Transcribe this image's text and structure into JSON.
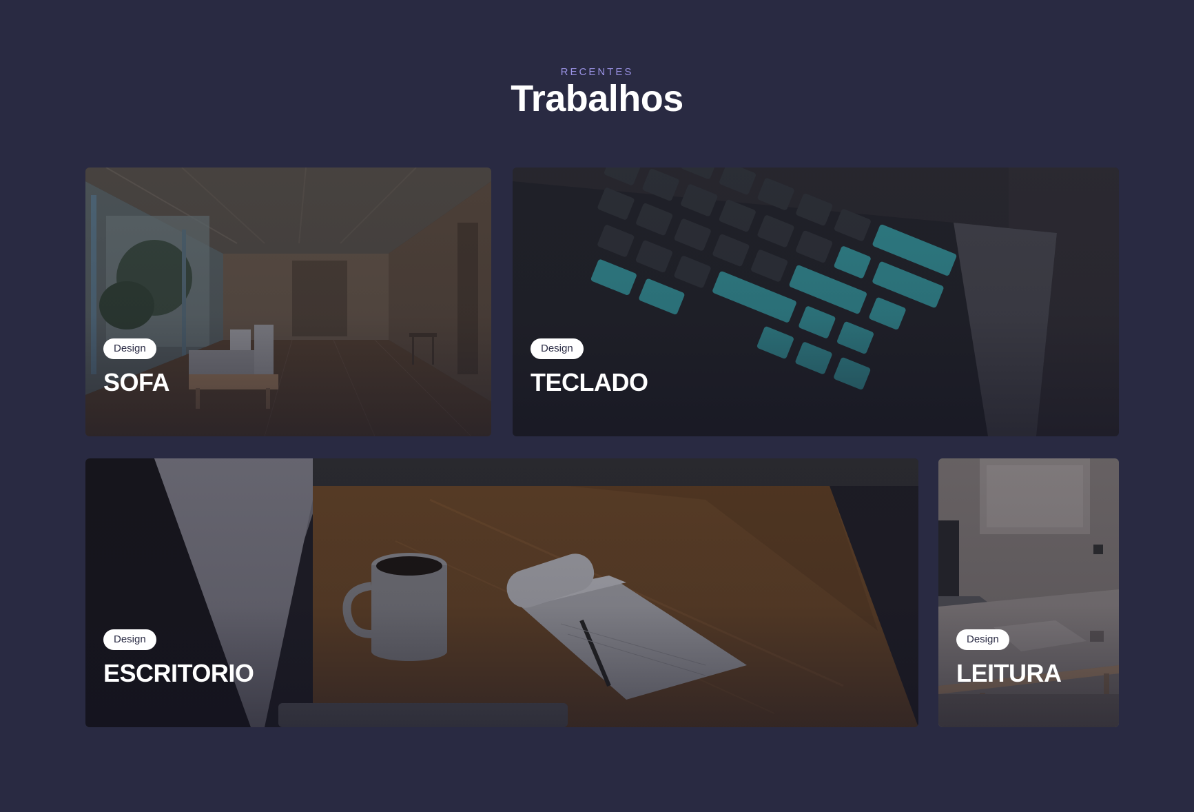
{
  "header": {
    "eyebrow": "RECENTES",
    "title": "Trabalhos"
  },
  "projects": [
    {
      "tag": "Design",
      "title": "SOFA",
      "image": "living-room-sofa-photo"
    },
    {
      "tag": "Design",
      "title": "TECLADO",
      "image": "mechanical-keyboard-photo"
    },
    {
      "tag": "Design",
      "title": "ESCRITORIO",
      "image": "desk-coffee-notepad-photo"
    },
    {
      "tag": "Design",
      "title": "LEITURA",
      "image": "reading-desk-photo"
    }
  ],
  "colors": {
    "background": "#292a42",
    "accent": "#9a92e4",
    "tag_background": "#ffffff",
    "tag_text": "#2a2b44"
  }
}
